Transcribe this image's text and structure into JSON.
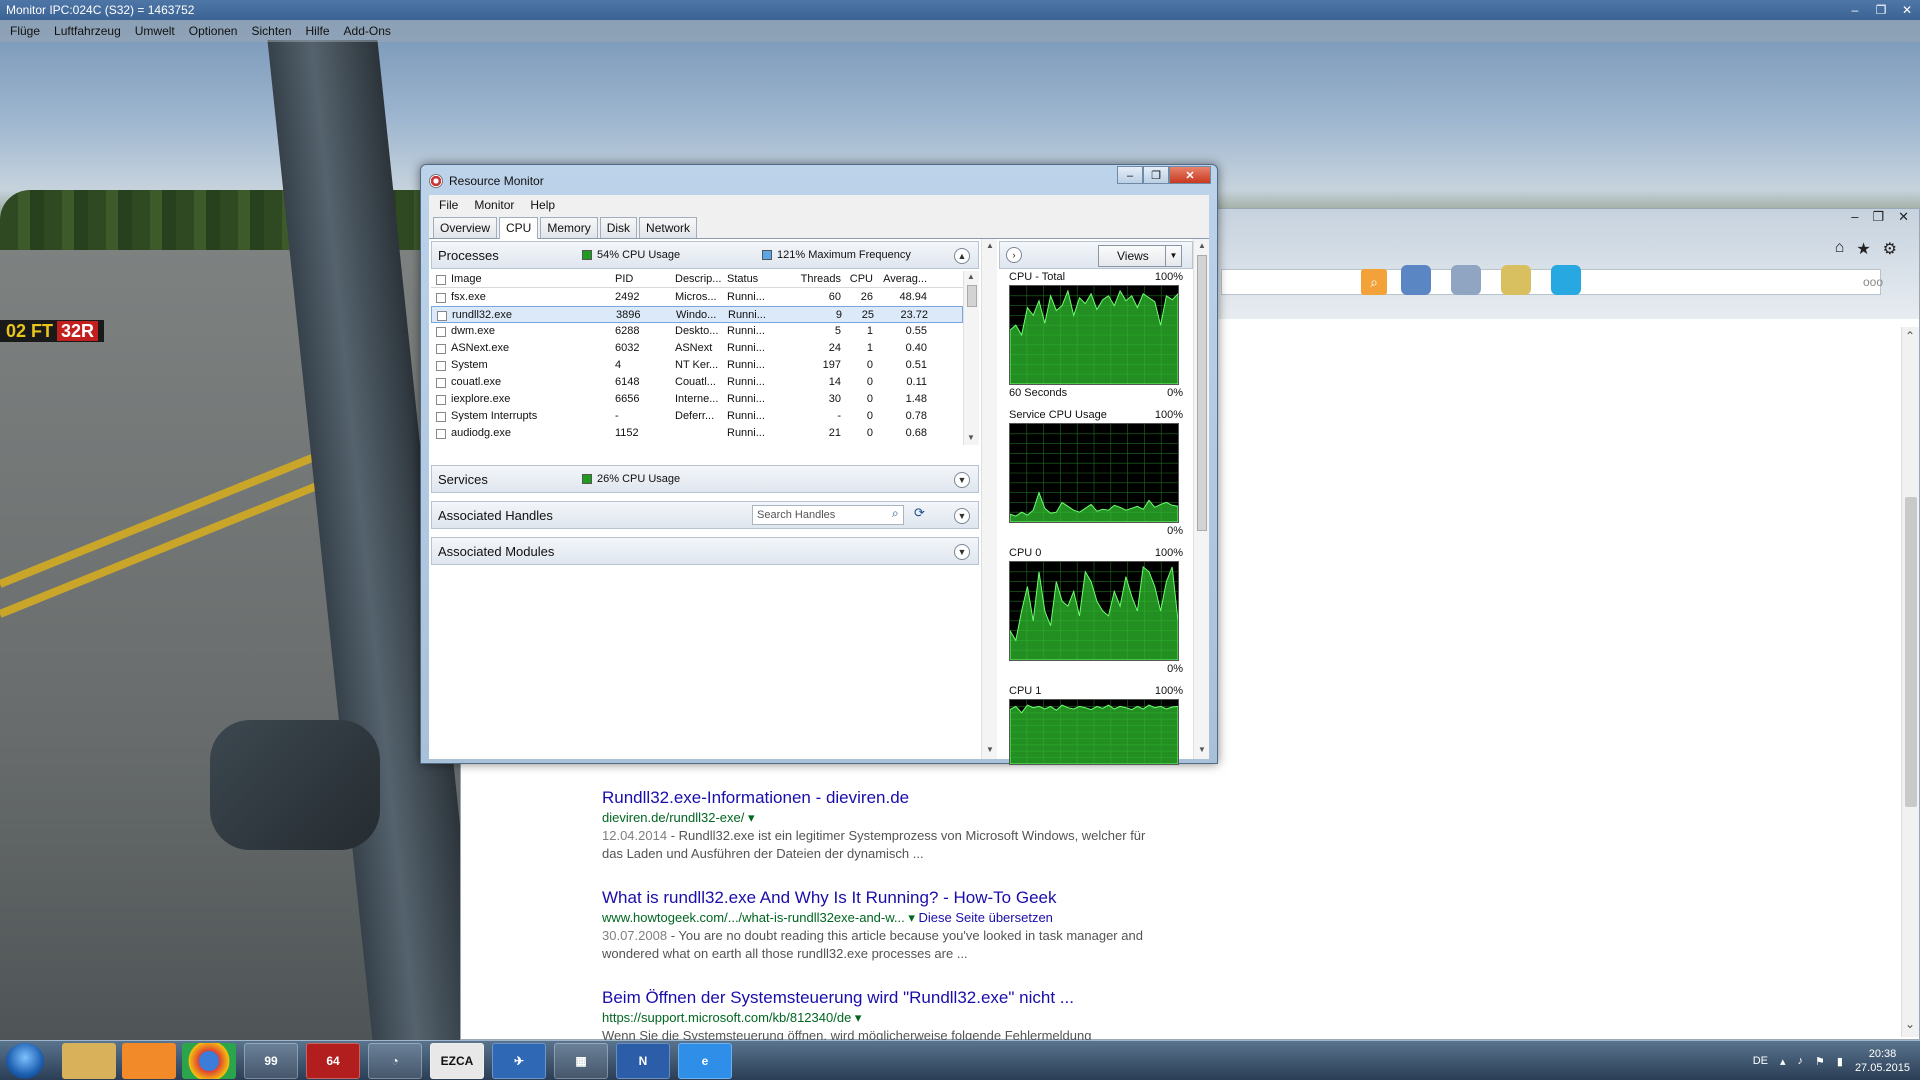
{
  "fsx": {
    "title": "Monitor IPC:024C (S32) = 1463752",
    "menu": [
      "Flüge",
      "Luftfahrzeug",
      "Umwelt",
      "Optionen",
      "Sichten",
      "Hilfe",
      "Add-Ons"
    ],
    "sign_text": "02 FT",
    "sign_runway": "32R"
  },
  "browser": {
    "more_dots": "ooo",
    "results": [
      {
        "title": "Rundll32.exe-Informationen - dieviren.de",
        "url": "dieviren.de/rundll32-exe/",
        "translate": "",
        "date": "12.04.2014",
        "snippet": "Rundll32.exe ist ein legitimer Systemprozess von Microsoft Windows, welcher für das Laden und Ausführen der Dateien der dynamisch ..."
      },
      {
        "title": "What is rundll32.exe And Why Is It Running? - How-To Geek",
        "url": "www.howtogeek.com/.../what-is-rundll32exe-and-w...",
        "translate": "Diese Seite übersetzen",
        "date": "30.07.2008",
        "snippet": "You are no doubt reading this article because you've looked in task manager and wondered what on earth all those rundll32.exe processes are ..."
      },
      {
        "title": "Beim Öffnen der Systemsteuerung wird \"Rundll32.exe\" nicht ...",
        "url": "https://support.microsoft.com/kb/812340/de",
        "translate": "",
        "date": "",
        "snippet": "Wenn Sie die Systemsteuerung öffnen, wird möglicherweise folgende Fehlermeldung"
      }
    ]
  },
  "rm": {
    "title": "Resource Monitor",
    "menu": [
      "File",
      "Monitor",
      "Help"
    ],
    "tabs": [
      "Overview",
      "CPU",
      "Memory",
      "Disk",
      "Network"
    ],
    "active_tab": "CPU",
    "processes": {
      "label": "Processes",
      "cpu_usage": "54% CPU Usage",
      "max_freq": "121% Maximum Frequency",
      "columns": [
        "Image",
        "PID",
        "Descrip...",
        "Status",
        "Threads",
        "CPU",
        "Averag..."
      ],
      "rows": [
        [
          "fsx.exe",
          "2492",
          "Micros...",
          "Runni...",
          "60",
          "26",
          "48.94"
        ],
        [
          "rundll32.exe",
          "3896",
          "Windo...",
          "Runni...",
          "9",
          "25",
          "23.72"
        ],
        [
          "dwm.exe",
          "6288",
          "Deskto...",
          "Runni...",
          "5",
          "1",
          "0.55"
        ],
        [
          "ASNext.exe",
          "6032",
          "ASNext",
          "Runni...",
          "24",
          "1",
          "0.40"
        ],
        [
          "System",
          "4",
          "NT Ker...",
          "Runni...",
          "197",
          "0",
          "0.51"
        ],
        [
          "couatl.exe",
          "6148",
          "Couatl...",
          "Runni...",
          "14",
          "0",
          "0.11"
        ],
        [
          "iexplore.exe",
          "6656",
          "Interne...",
          "Runni...",
          "30",
          "0",
          "1.48"
        ],
        [
          "System Interrupts",
          "-",
          "Deferr...",
          "Runni...",
          "-",
          "0",
          "0.78"
        ],
        [
          "audiodg.exe",
          "1152",
          "",
          "Runni...",
          "21",
          "0",
          "0.68"
        ]
      ],
      "selected_row": 1
    },
    "services": {
      "label": "Services",
      "cpu_usage": "26% CPU Usage"
    },
    "handles": {
      "label": "Associated Handles",
      "search_placeholder": "Search Handles"
    },
    "modules": {
      "label": "Associated Modules"
    },
    "views_label": "Views",
    "graphs": [
      {
        "title": "CPU - Total",
        "max": "100%",
        "bottom_left": "60 Seconds",
        "bottom_right": "0%",
        "values": [
          0.55,
          0.6,
          0.5,
          0.78,
          0.7,
          0.85,
          0.62,
          0.9,
          0.75,
          0.8,
          0.95,
          0.7,
          0.88,
          0.82,
          0.92,
          0.76,
          0.86,
          0.9,
          0.8,
          0.95,
          0.85,
          0.9,
          0.78,
          0.92,
          0.88,
          0.84,
          0.6,
          0.9,
          0.86,
          0.92
        ]
      },
      {
        "title": "Service CPU Usage",
        "max": "100%",
        "bottom_left": "",
        "bottom_right": "0%",
        "values": [
          0.08,
          0.06,
          0.1,
          0.07,
          0.12,
          0.3,
          0.14,
          0.09,
          0.1,
          0.2,
          0.16,
          0.12,
          0.1,
          0.14,
          0.18,
          0.11,
          0.13,
          0.12,
          0.17,
          0.15,
          0.12,
          0.14,
          0.16,
          0.13,
          0.22,
          0.15,
          0.18,
          0.2,
          0.17,
          0.16
        ]
      },
      {
        "title": "CPU 0",
        "max": "100%",
        "bottom_left": "",
        "bottom_right": "0%",
        "values": [
          0.3,
          0.2,
          0.5,
          0.75,
          0.4,
          0.9,
          0.5,
          0.35,
          0.8,
          0.6,
          0.55,
          0.7,
          0.45,
          0.9,
          0.8,
          0.6,
          0.5,
          0.45,
          0.7,
          0.55,
          0.85,
          0.65,
          0.5,
          0.95,
          0.9,
          0.75,
          0.5,
          0.8,
          0.95,
          0.4
        ]
      },
      {
        "title": "CPU 1",
        "max": "100%",
        "bottom_left": "",
        "bottom_right": "",
        "values": [
          0.85,
          0.9,
          0.8,
          0.92,
          0.88,
          0.9,
          0.86,
          0.9,
          0.84,
          0.92,
          0.88,
          0.86,
          0.9,
          0.88,
          0.85,
          0.9,
          0.87,
          0.92,
          0.86,
          0.9,
          0.88,
          0.85,
          0.9,
          0.86,
          0.92,
          0.88,
          0.9,
          0.86,
          0.89,
          0.9
        ]
      }
    ]
  },
  "taskbar": {
    "items": [
      "99",
      "64",
      "EZCA"
    ],
    "lang": "DE",
    "time": "20:38",
    "date": "27.05.2015"
  },
  "colors": {
    "graph_green": "#2fbf2f",
    "graph_bg": "#000000",
    "link": "#1a0dab",
    "url": "#006621"
  }
}
